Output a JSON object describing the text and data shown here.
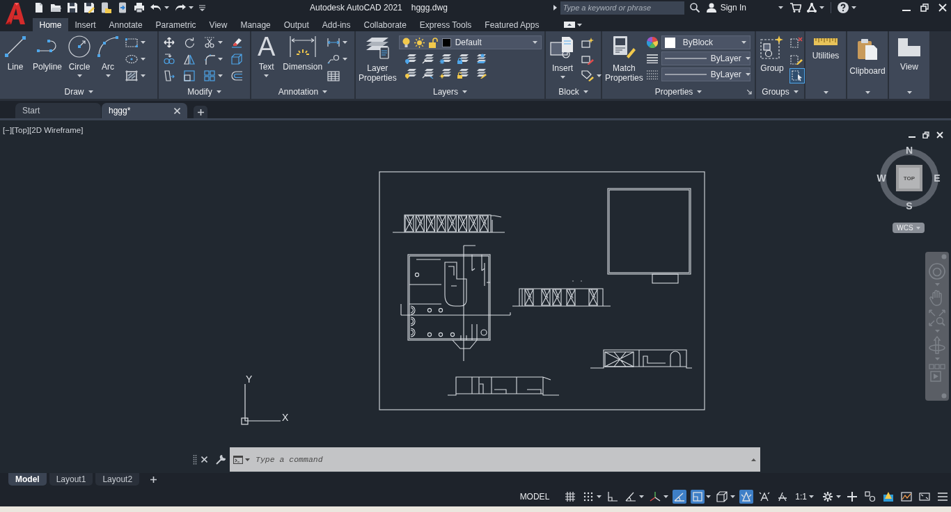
{
  "window": {
    "title": "Autodesk AutoCAD 2021",
    "file_name": "hggg.dwg",
    "search": {
      "placeholder": "Type a keyword or phrase"
    },
    "sign_in": "Sign In"
  },
  "ribbon_tabs": [
    {
      "label": "Home",
      "selected": true
    },
    {
      "label": "Insert",
      "selected": false
    },
    {
      "label": "Annotate",
      "selected": false
    },
    {
      "label": "Parametric",
      "selected": false
    },
    {
      "label": "View",
      "selected": false
    },
    {
      "label": "Manage",
      "selected": false
    },
    {
      "label": "Output",
      "selected": false
    },
    {
      "label": "Add-ins",
      "selected": false
    },
    {
      "label": "Collaborate",
      "selected": false
    },
    {
      "label": "Express Tools",
      "selected": false
    },
    {
      "label": "Featured Apps",
      "selected": false
    }
  ],
  "ribbon_panels": [
    {
      "kind": "draw",
      "title": "Draw",
      "tools": [
        {
          "label": "Line",
          "dropdown": false
        },
        {
          "label": "Polyline",
          "dropdown": false
        },
        {
          "label": "Circle",
          "dropdown": true
        },
        {
          "label": "Arc",
          "dropdown": true
        }
      ]
    },
    {
      "kind": "modify",
      "title": "Modify"
    },
    {
      "kind": "annotation",
      "title": "Annotation",
      "tools": [
        {
          "label": "Text",
          "glyph": "A",
          "dropdown": true
        },
        {
          "label": "Dimension",
          "dropdown": false
        }
      ]
    },
    {
      "kind": "layers",
      "title": "Layers",
      "tools": [
        {
          "label": "Layer Properties",
          "dropdown": false
        }
      ],
      "current_layer": "Default"
    },
    {
      "kind": "block",
      "title": "Block",
      "tools": [
        {
          "label": "Insert",
          "dropdown": true
        }
      ]
    },
    {
      "kind": "properties",
      "title": "Properties",
      "tools": [
        {
          "label": "Match Properties",
          "dropdown": false
        }
      ],
      "color_setting": "ByBlock",
      "linetype": "ByLayer",
      "lineweight": "ByLayer"
    },
    {
      "kind": "groups",
      "title": "Groups",
      "tools": [
        {
          "label": "Group",
          "dropdown": false
        }
      ],
      "group_selection": {
        "on": true
      }
    },
    {
      "kind": "utilities",
      "tools": [
        {
          "label": "Utilities"
        }
      ]
    },
    {
      "kind": "clipboard",
      "tools": [
        {
          "label": "Clipboard"
        }
      ]
    },
    {
      "kind": "view",
      "tools": [
        {
          "label": "View"
        }
      ]
    }
  ],
  "file_tabs": [
    {
      "label": "Start",
      "selected": false,
      "closable": false
    },
    {
      "label": "hggg*",
      "selected": true,
      "closable": true
    }
  ],
  "viewport": {
    "controls": [
      "[−]",
      "[Top]",
      "[2D Wireframe]"
    ],
    "viewcube": {
      "face": "TOP",
      "north": "N",
      "south": "S",
      "east": "E",
      "west": "W",
      "coordinate_system": "WCS"
    },
    "ucs_icon": {
      "y_label": "Y",
      "x_label": "X"
    }
  },
  "command_line": {
    "placeholder": "Type a command"
  },
  "layout_tabs": [
    {
      "label": "Model",
      "selected": true
    },
    {
      "label": "Layout1",
      "selected": false
    },
    {
      "label": "Layout2",
      "selected": false
    }
  ],
  "status_bar": {
    "space": "MODEL",
    "toggles": [
      {
        "on": false,
        "dropdown": false
      },
      {
        "on": false,
        "dropdown": true
      },
      {
        "on": false,
        "dropdown": false
      },
      {
        "on": false,
        "dropdown": true
      },
      {
        "on": false,
        "dropdown": true
      },
      {
        "on": true,
        "dropdown": false
      },
      {
        "on": true,
        "dropdown": true
      },
      {
        "on": false,
        "dropdown": true
      },
      {
        "on": true,
        "dropdown": false
      },
      {
        "on": false,
        "dropdown": false
      }
    ],
    "annotation_scale": "1:1"
  }
}
